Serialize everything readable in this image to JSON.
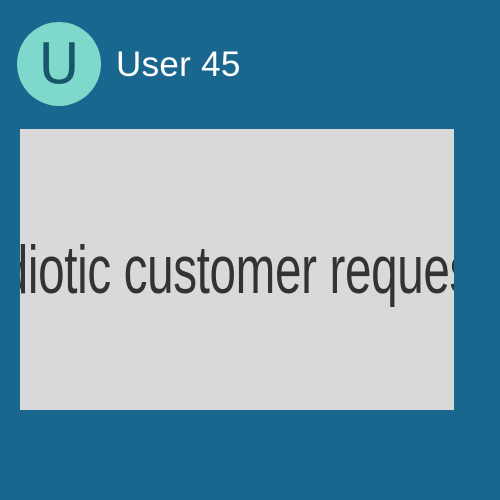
{
  "user": {
    "avatar_letter": "U",
    "name": "User 45"
  },
  "message": {
    "text": "[Idiotic customer request]"
  },
  "colors": {
    "background": "#19678f",
    "avatar_bg": "#7fd8cc",
    "avatar_letter": "#17566b",
    "card_bg": "#d9d9d9",
    "card_text": "#333333"
  }
}
